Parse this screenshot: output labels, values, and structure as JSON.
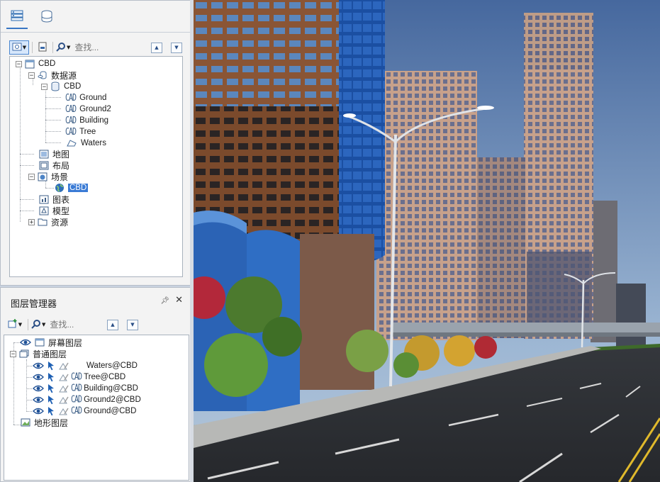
{
  "workspace": {
    "search_placeholder": "查找...",
    "tree": {
      "root": "CBD",
      "datasource_group": "数据源",
      "datasource": "CBD",
      "datasets": [
        "Ground",
        "Ground2",
        "Building",
        "Tree",
        "Waters"
      ],
      "maps": "地图",
      "layouts": "布局",
      "scenes": "场景",
      "scene_item": "CBD",
      "charts": "图表",
      "models": "模型",
      "resources": "资源"
    }
  },
  "layer_manager": {
    "title": "图层管理器",
    "search_placeholder": "查找...",
    "screen_layers": "屏幕图层",
    "normal_layers": "普通图层",
    "layers": [
      "Waters@CBD",
      "Tree@CBD",
      "Building@CBD",
      "Ground2@CBD",
      "Ground@CBD"
    ],
    "terrain_layers": "地形图层"
  },
  "colors": {
    "selection": "#3a7bd5",
    "panel_bg": "#f3f3f3",
    "sky_top": "#46689e",
    "sky_bottom": "#a7bfd8"
  },
  "icons": [
    "workspace-icon",
    "datasource-manager-icon",
    "view-mode-icon",
    "open-icon",
    "search-icon",
    "move-up-icon",
    "move-down-icon",
    "pin-icon",
    "close-icon",
    "visible-eye-icon",
    "selectable-arrow-icon",
    "editable-icon",
    "cad-dataset-icon",
    "region-dataset-icon"
  ]
}
